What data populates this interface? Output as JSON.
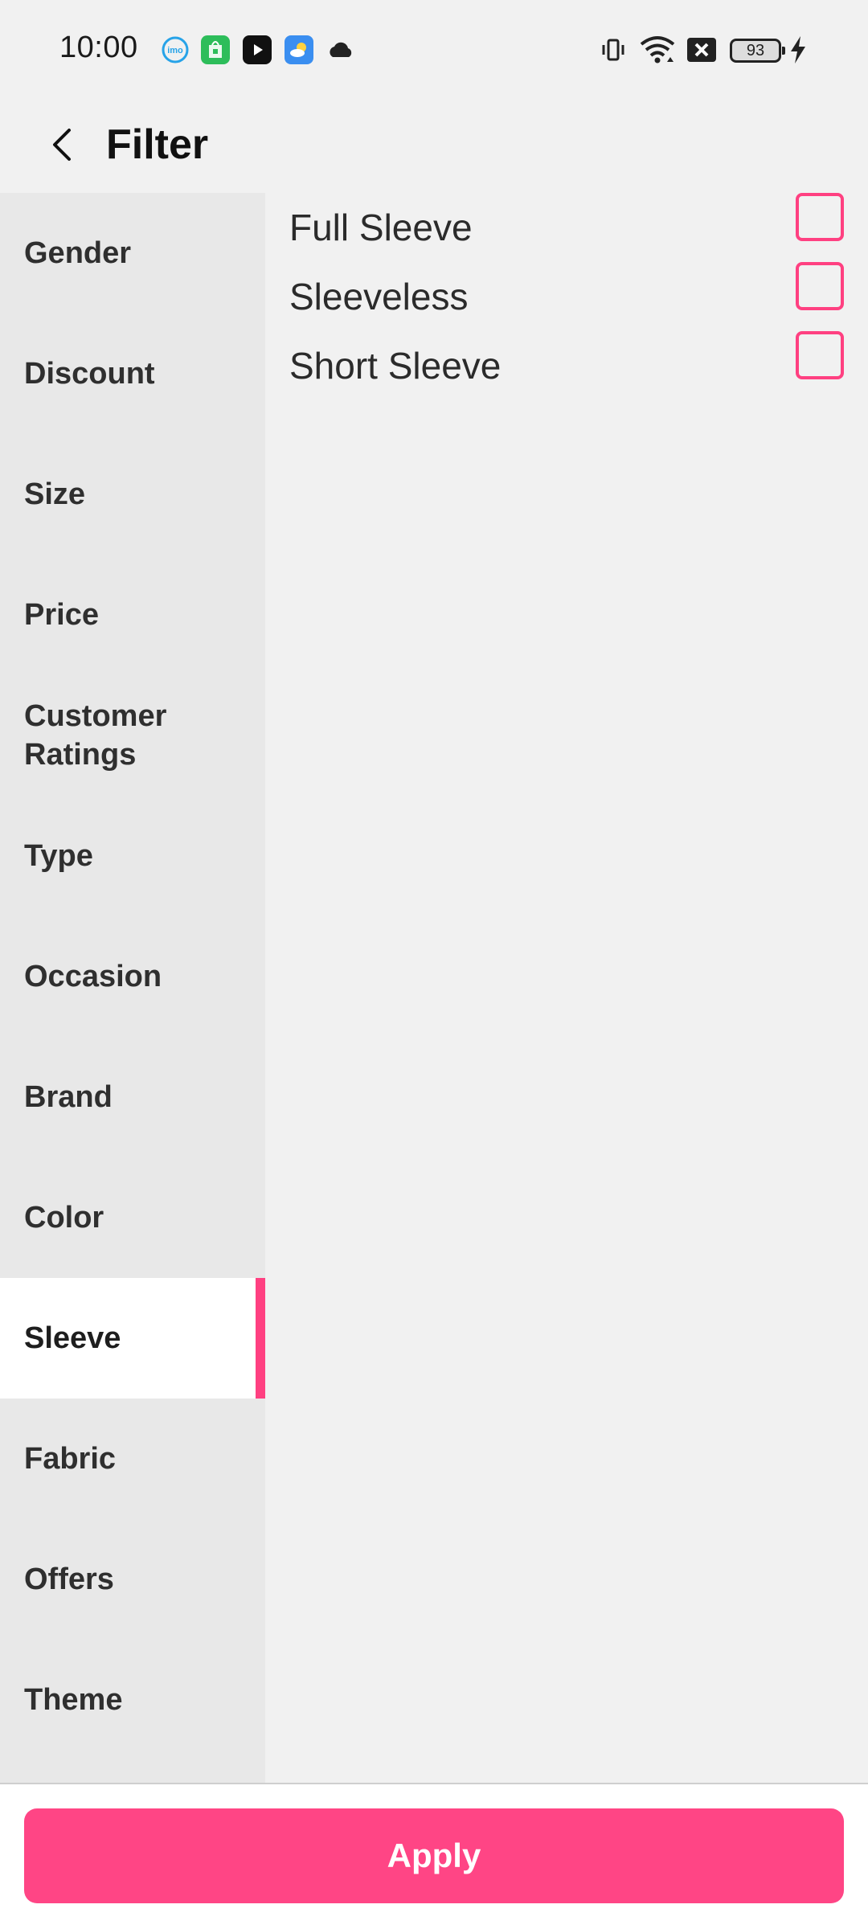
{
  "status_bar": {
    "time": "10:00",
    "battery_level": "93",
    "notification_icons": [
      "imo-icon",
      "app-store-icon",
      "youtube-icon",
      "weather-icon",
      "cloud-icon"
    ],
    "system_icons": [
      "vibrate-icon",
      "wifi-icon",
      "sim-off-icon",
      "battery-icon",
      "charging-icon"
    ]
  },
  "header": {
    "title": "Filter"
  },
  "sidebar": {
    "items": [
      {
        "label": "Gender"
      },
      {
        "label": "Discount"
      },
      {
        "label": "Size"
      },
      {
        "label": "Price"
      },
      {
        "label": "Customer Ratings"
      },
      {
        "label": "Type"
      },
      {
        "label": "Occasion"
      },
      {
        "label": "Brand"
      },
      {
        "label": "Color"
      },
      {
        "label": "Sleeve",
        "active": true
      },
      {
        "label": "Fabric"
      },
      {
        "label": "Offers"
      },
      {
        "label": "Theme"
      }
    ]
  },
  "options": {
    "items": [
      {
        "label": "Full Sleeve",
        "checked": false
      },
      {
        "label": "Sleeveless",
        "checked": false
      },
      {
        "label": "Short Sleeve",
        "checked": false
      }
    ]
  },
  "footer": {
    "apply_label": "Apply"
  },
  "colors": {
    "accent": "#ff4081",
    "button": "#ff4585",
    "sidebar_bg": "#e8e8e8",
    "page_bg": "#f1f1f1"
  }
}
